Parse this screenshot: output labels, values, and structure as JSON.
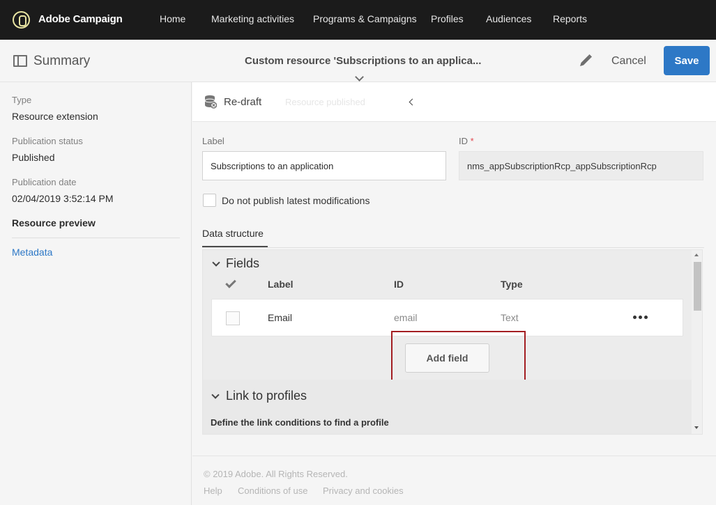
{
  "topbar": {
    "brand": "Adobe Campaign",
    "nav": [
      "Home",
      "Marketing activities",
      "Programs & Campaigns",
      "Profiles",
      "Audiences",
      "Reports"
    ]
  },
  "header": {
    "summary_label": "Summary",
    "document_title": "Custom resource 'Subscriptions to an applica...",
    "cancel_label": "Cancel",
    "save_label": "Save"
  },
  "sidebar": {
    "type_label": "Type",
    "type_value": "Resource extension",
    "publication_status_label": "Publication status",
    "publication_status_value": "Published",
    "publication_date_label": "Publication date",
    "publication_date_value": "02/04/2019 3:52:14 PM",
    "resource_preview": "Resource preview",
    "metadata_link": "Metadata"
  },
  "main": {
    "redraft_label": "Re-draft",
    "faded_status": "Resource published",
    "label_field_label": "Label",
    "label_field_value": "Subscriptions to an application",
    "id_field_label": "ID",
    "id_required_mark": "*",
    "id_field_value": "nms_appSubscriptionRcp_appSubscriptionRcp",
    "no_publish_checkbox_label": "Do not publish latest modifications",
    "tab_label": "Data structure"
  },
  "fields_section": {
    "title": "Fields",
    "columns": {
      "label": "Label",
      "id": "ID",
      "type": "Type"
    },
    "rows": [
      {
        "label": "Email",
        "id": "email",
        "type": "Text"
      }
    ],
    "add_field_label": "Add field"
  },
  "link_section": {
    "title": "Link to profiles",
    "description": "Define the link conditions to find a profile"
  },
  "footer": {
    "copyright": "© 2019 Adobe. All Rights Reserved.",
    "links": [
      "Help",
      "Conditions of use",
      "Privacy and cookies"
    ]
  },
  "colors": {
    "topbar_bg": "#1b1b1b",
    "accent_blue": "#2d78c6",
    "highlight_red": "#a31e22",
    "required_red": "#e34850"
  },
  "icons": [
    "adobe-campaign-logo-icon",
    "summary-panel-icon",
    "chevron-down-icon",
    "pencil-icon",
    "database-icon",
    "chevron-left-icon",
    "checkmark-icon",
    "more-options-icon"
  ]
}
